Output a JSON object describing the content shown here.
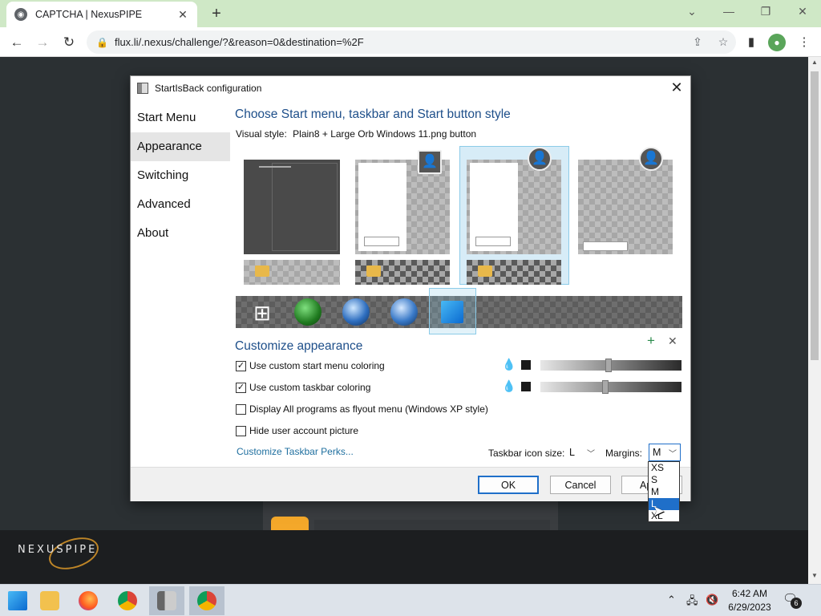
{
  "browser": {
    "tab_title": "CAPTCHA | NexusPIPE",
    "url": "flux.li/.nexus/challenge/?&reason=0&destination=%2F",
    "new_tab_label": "+",
    "profile_initial": "●"
  },
  "page": {
    "logo_text": "NEXUSPIPE"
  },
  "dialog": {
    "title": "StartIsBack configuration",
    "nav": [
      "Start Menu",
      "Appearance",
      "Switching",
      "Advanced",
      "About"
    ],
    "active_nav_index": 1,
    "style_section_title": "Choose Start menu, taskbar and Start button style",
    "visual_style_label": "Visual style:",
    "visual_style_value": "Plain8 + Large Orb Windows 11.png button",
    "customize_title": "Customize appearance",
    "checkboxes": [
      {
        "label": "Use custom start menu coloring",
        "checked": true
      },
      {
        "label": "Use custom taskbar coloring",
        "checked": true
      },
      {
        "label": "Display All programs as flyout menu (Windows XP style)",
        "checked": false
      },
      {
        "label": "Hide user account picture",
        "checked": false
      }
    ],
    "slider_levels": [
      0.48,
      0.46
    ],
    "link_text": "Customize Taskbar Perks...",
    "icon_size_label": "Taskbar icon size:",
    "icon_size_value": "L",
    "margins_label": "Margins:",
    "margins_value": "M",
    "margins_options": [
      "XS",
      "S",
      "M",
      "L",
      "XL"
    ],
    "margins_highlight_index": 3,
    "buttons": {
      "ok": "OK",
      "cancel": "Cancel",
      "apply": "Apply"
    }
  },
  "taskbar": {
    "time": "6:42 AM",
    "date": "6/29/2023",
    "notification_count": "6"
  },
  "colors": {
    "accent": "#1f6fc9",
    "section_title": "#1e4f8a",
    "tab_strip": "#cfe8c6"
  }
}
